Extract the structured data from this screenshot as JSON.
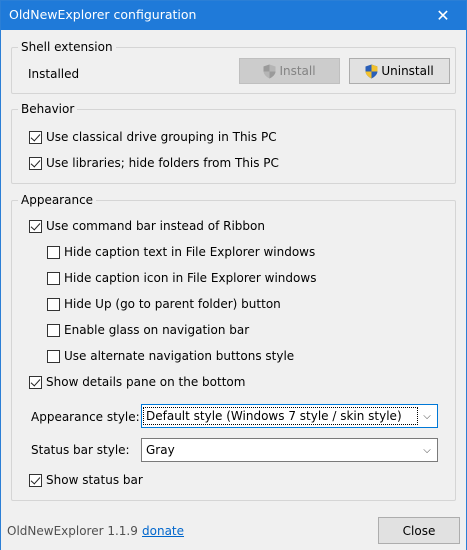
{
  "window": {
    "title": "OldNewExplorer configuration",
    "close_glyph": "✕"
  },
  "shell": {
    "legend": "Shell extension",
    "status": "Installed",
    "install_label": "Install",
    "uninstall_label": "Uninstall"
  },
  "behavior": {
    "legend": "Behavior",
    "items": [
      {
        "label": "Use classical drive grouping in This PC",
        "checked": true
      },
      {
        "label": "Use libraries; hide folders from This PC",
        "checked": true
      }
    ]
  },
  "appearance": {
    "legend": "Appearance",
    "command_bar": {
      "label": "Use command bar instead of Ribbon",
      "checked": true
    },
    "sub_items": [
      {
        "label": "Hide caption text in File Explorer windows",
        "checked": false
      },
      {
        "label": "Hide caption icon in File Explorer windows",
        "checked": false
      },
      {
        "label": "Hide Up (go to parent folder) button",
        "checked": false
      },
      {
        "label": "Enable glass on navigation bar",
        "checked": false
      },
      {
        "label": "Use alternate navigation buttons style",
        "checked": false
      }
    ],
    "details_pane": {
      "label": "Show details pane on the bottom",
      "checked": true
    },
    "style_label": "Appearance style:",
    "style_value": "Default style (Windows 7 style / skin style)",
    "statusbar_label": "Status bar style:",
    "statusbar_value": "Gray",
    "show_statusbar": {
      "label": "Show status bar",
      "checked": true
    }
  },
  "footer": {
    "version": "OldNewExplorer 1.1.9",
    "donate": "donate",
    "close_label": "Close"
  },
  "colors": {
    "titlebar": "#1f7ad9",
    "link": "#0066cc",
    "focus": "#0078d7"
  }
}
